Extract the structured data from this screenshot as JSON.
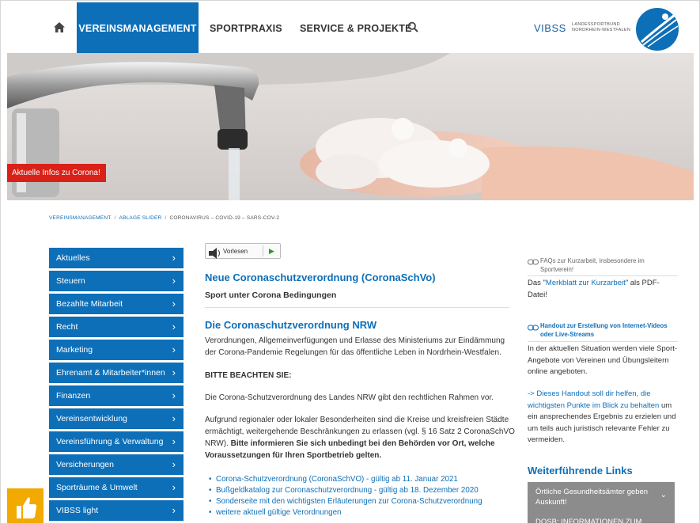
{
  "nav": {
    "home_icon": "home-icon",
    "items": [
      {
        "label": "VEREINSMANAGEMENT",
        "active": true
      },
      {
        "label": "SPORTPRAXIS"
      },
      {
        "label": "SERVICE & PROJEKTE"
      }
    ],
    "search_icon": "search-icon",
    "vibss": "VIBSS",
    "logo_text_line1": "LANDESSPORTBUND",
    "logo_text_line2": "NORDRHEIN-WESTFALEN",
    "accent_color": "#0d6fb8"
  },
  "hero": {
    "badge": "Aktuelle Infos zu Corona!",
    "badge_color": "#d92118"
  },
  "breadcrumb": {
    "items": [
      "VEREINSMANAGEMENT",
      "ABLAGE SLIDER",
      "CORONAVIRUS – COVID-19 – SARS-COV-2"
    ],
    "separator": "/"
  },
  "sidebar": {
    "items": [
      {
        "label": "Aktuelles"
      },
      {
        "label": "Steuern"
      },
      {
        "label": "Bezahlte Mitarbeit"
      },
      {
        "label": "Recht"
      },
      {
        "label": "Marketing"
      },
      {
        "label": "Ehrenamt & Mitarbeiter*innen"
      },
      {
        "label": "Finanzen"
      },
      {
        "label": "Vereinsentwicklung"
      },
      {
        "label": "Vereinsführung & Verwaltung"
      },
      {
        "label": "Versicherungen"
      },
      {
        "label": "Sporträume & Umwelt"
      },
      {
        "label": "VIBSS light"
      }
    ],
    "chevron": "›"
  },
  "main": {
    "vorlesen_label": "Vorlesen",
    "title": "Neue Coronaschutzverordnung (CoronaSchVo)",
    "subtitle": "Sport unter Corona Bedingungen",
    "section_title": "Die Coronaschutzverordnung NRW",
    "p1": "Verordnungen, Allgemeinverfügungen und Erlasse des Ministeriums zur Eindämmung der Corona-Pandemie Regelungen für das öffentliche Leben in Nordrhein-Westfalen.",
    "bitte": "BITTE BEACHTEN SIE:",
    "p2": "Die Corona-Schutzverordnung des Landes NRW gibt den rechtlichen Rahmen vor.",
    "p3_plain": "Aufgrund regionaler oder lokaler Besonderheiten sind die Kreise und kreisfreien Städte ermächtigt, weitergehende Beschränkungen zu erlassen (vgl. § 16 Satz 2 CoronaSchVO NRW). ",
    "p3_bold": "Bitte informieren Sie sich unbedingt bei den Behörden vor Ort, welche Voraussetzungen für Ihren Sportbetrieb gelten.",
    "links": [
      "Corona-Schutzverordnung (CoronaSchVO) - gültig ab 11. Januar 2021",
      "Bußgeldkatalog zur Coronaschutzverordnung - gültig ab 18. Dezember 2020",
      "Sonderseite mit den wichtigsten Erläuterungen zur Corona-Schutzverordnung",
      "weitere aktuell gültige Verordnungen"
    ]
  },
  "right": {
    "faq_title": "FAQs zur Kurzarbeit, insbesondere im Sportverein!",
    "faq_text_before": "Das \"",
    "faq_link": "Merkblatt zur Kurzarbeit",
    "faq_text_after": "\" als PDF-Datei!",
    "handout_title": "Handout zur Erstellung von Internet-Videos oder Live-Streams",
    "handout_text": "In der aktuellen Situation werden viele Sport-Angebote von Vereinen und Übungsleitern online angeboten.",
    "handout_link": "-> Dieses Handout soll dir helfen, die wichtigsten Punkte im Blick zu behalten",
    "handout_rest": " um ein ansprechendes Ergebnis zu erzielen und um teils auch juristisch relevante Fehler zu vermeiden.",
    "weiter_title": "Weiterführende Links",
    "acc1": "Örtliche Gesundheitsämter geben Auskunft!",
    "acc2": "DOSB: INFORMATIONEN ZUM"
  }
}
